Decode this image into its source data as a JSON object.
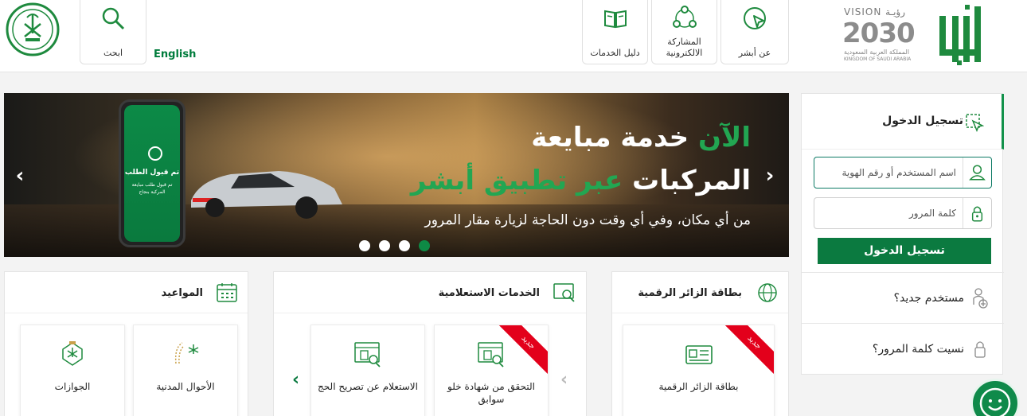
{
  "header": {
    "nav": [
      {
        "label": "عن أبشر",
        "icon": "cursor-circle-icon"
      },
      {
        "label": "المشاركة الالكترونية",
        "icon": "network-icon"
      },
      {
        "label": "دليل الخدمات",
        "icon": "book-icon"
      }
    ],
    "search_label": "ابحث",
    "language_label": "English",
    "vision": {
      "top": "VISION رؤيـة",
      "num": "2030",
      "ar": "المملكة العربية السعودية",
      "en": "KINGDOM OF SAUDI ARABIA"
    }
  },
  "banner": {
    "title_line1_green": "الآن",
    "title_line1_white": "خدمة مبايعة",
    "title_line2_white": "المركبات",
    "title_line2_green": "عبر تطبيق أبشر",
    "subtitle": "من أي مكان، وفي أي وقت دون الحاجة لزيارة مقار المرور",
    "phone_title": "تم قبول الطلب",
    "phone_text": "تم قبول طلب مبايعة المركبة بنجاح",
    "active_slide": 1,
    "slides": 4
  },
  "login": {
    "title": "تسجيل الدخول",
    "username_placeholder": "اسم المستخدم أو رقم الهوية",
    "password_placeholder": "كلمة المرور",
    "submit": "تسجيل الدخول",
    "new_user": "مستخدم جديد؟",
    "forgot": "نسيت كلمة المرور؟"
  },
  "cards": {
    "visitor": {
      "title": "بطاقة الزائر الرقمية",
      "tiles": [
        {
          "label": "بطاقة الزائر الرقمية",
          "badge": "جديد"
        }
      ]
    },
    "inquiry": {
      "title": "الخدمات الاستعلامية",
      "tiles": [
        {
          "label": "التحقق من شهادة خلو سوابق",
          "badge": "جديد"
        },
        {
          "label": "الاستعلام عن تصريح الحج",
          "badge": ""
        }
      ]
    },
    "appointments": {
      "title": "المواعيد",
      "tiles": [
        {
          "label": "الأحوال المدنية",
          "logo_text": "الأحوال المدنية"
        },
        {
          "label": "الجوازات"
        }
      ]
    }
  },
  "colors": {
    "brand": "#0b7a40",
    "accent": "#22a652",
    "badge": "#e3001b"
  }
}
